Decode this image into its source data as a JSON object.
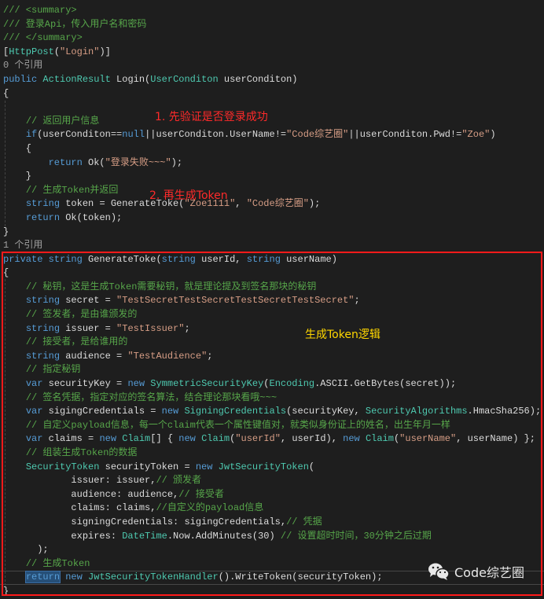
{
  "colors": {
    "background": "#1e1e1e",
    "keyword": "#569cd6",
    "type": "#4ec9b0",
    "string": "#d69d85",
    "comment": "#57a64a",
    "highlight_box": "#ff1a1a",
    "annotation_red": "#ff2a2a",
    "annotation_yellow": "#ffd700"
  },
  "annotations": {
    "step1": "1. 先验证是否登录成功",
    "step2": "2. 再生成Token",
    "box_label": "生成Token逻辑"
  },
  "watermark": {
    "icon": "wechat-icon",
    "text": "Code综艺圈"
  },
  "code_lines": [
    [
      [
        "cm",
        "/// <summary>"
      ]
    ],
    [
      [
        "cm",
        "/// 登录Api，传入用户名和密码"
      ]
    ],
    [
      [
        "cm",
        "/// </summary>"
      ]
    ],
    [
      [
        "pl",
        "["
      ],
      [
        "ty",
        "HttpPost"
      ],
      [
        "pl",
        "("
      ],
      [
        "str",
        "\"Login\""
      ],
      [
        "pl",
        ")]"
      ]
    ],
    [
      [
        "ref",
        "0 个引用"
      ]
    ],
    [
      [
        "kw",
        "public "
      ],
      [
        "ty",
        "ActionResult"
      ],
      [
        "pl",
        " Login("
      ],
      [
        "ty",
        "UserConditon"
      ],
      [
        "pl",
        " userConditon)"
      ]
    ],
    [
      [
        "pl",
        "{"
      ]
    ],
    [],
    [
      [
        "pl",
        "    "
      ],
      [
        "cm",
        "// 返回用户信息"
      ]
    ],
    [
      [
        "pl",
        "    "
      ],
      [
        "kw",
        "if"
      ],
      [
        "pl",
        "(userConditon=="
      ],
      [
        "kw",
        "null"
      ],
      [
        "pl",
        "||userConditon.UserName!="
      ],
      [
        "str",
        "\"Code综艺圈\""
      ],
      [
        "pl",
        "||userConditon.Pwd!="
      ],
      [
        "str",
        "\"Zoe\""
      ],
      [
        "pl",
        ")"
      ]
    ],
    [
      [
        "pl",
        "    {"
      ]
    ],
    [
      [
        "pl",
        "        "
      ],
      [
        "kw",
        "return"
      ],
      [
        "pl",
        " Ok("
      ],
      [
        "str",
        "\"登录失败~~~\""
      ],
      [
        "pl",
        ");"
      ]
    ],
    [
      [
        "pl",
        "    }"
      ]
    ],
    [
      [
        "pl",
        "    "
      ],
      [
        "cm",
        "// 生成Token并返回"
      ]
    ],
    [
      [
        "pl",
        "    "
      ],
      [
        "kw",
        "string"
      ],
      [
        "pl",
        " token = GenerateToke("
      ],
      [
        "str",
        "\"Zoe1111\""
      ],
      [
        "pl",
        ", "
      ],
      [
        "str",
        "\"Code综艺圈\""
      ],
      [
        "pl",
        ");"
      ]
    ],
    [
      [
        "pl",
        "    "
      ],
      [
        "kw",
        "return"
      ],
      [
        "pl",
        " Ok(token);"
      ]
    ],
    [
      [
        "pl",
        "}"
      ]
    ],
    [
      [
        "ref",
        "1 个引用"
      ]
    ],
    [
      [
        "kw",
        "private string"
      ],
      [
        "pl",
        " GenerateToke("
      ],
      [
        "kw",
        "string"
      ],
      [
        "pl",
        " userId, "
      ],
      [
        "kw",
        "string"
      ],
      [
        "pl",
        " userName)"
      ]
    ],
    [
      [
        "pl",
        "{"
      ]
    ],
    [
      [
        "pl",
        "    "
      ],
      [
        "cm",
        "// 秘钥，这是生成Token需要秘钥，就是理论提及到签名那块的秘钥"
      ]
    ],
    [
      [
        "pl",
        "    "
      ],
      [
        "kw",
        "string"
      ],
      [
        "pl",
        " secret = "
      ],
      [
        "str",
        "\"TestSecretTestSecretTestSecretTestSecret\""
      ],
      [
        "pl",
        ";"
      ]
    ],
    [
      [
        "pl",
        "    "
      ],
      [
        "cm",
        "// 签发者，是由谁颁发的"
      ]
    ],
    [
      [
        "pl",
        "    "
      ],
      [
        "kw",
        "string"
      ],
      [
        "pl",
        " issuer = "
      ],
      [
        "str",
        "\"TestIssuer\""
      ],
      [
        "pl",
        ";"
      ]
    ],
    [
      [
        "pl",
        "    "
      ],
      [
        "cm",
        "// 接受者，是给谁用的"
      ]
    ],
    [
      [
        "pl",
        "    "
      ],
      [
        "kw",
        "string"
      ],
      [
        "pl",
        " audience = "
      ],
      [
        "str",
        "\"TestAudience\""
      ],
      [
        "pl",
        ";"
      ]
    ],
    [
      [
        "pl",
        "    "
      ],
      [
        "cm",
        "// 指定秘钥"
      ]
    ],
    [
      [
        "pl",
        "    "
      ],
      [
        "kw",
        "var"
      ],
      [
        "pl",
        " securityKey = "
      ],
      [
        "kw",
        "new "
      ],
      [
        "ty",
        "SymmetricSecurityKey"
      ],
      [
        "pl",
        "("
      ],
      [
        "ty",
        "Encoding"
      ],
      [
        "pl",
        ".ASCII.GetBytes(secret));"
      ]
    ],
    [
      [
        "pl",
        "    "
      ],
      [
        "cm",
        "// 签名凭据，指定对应的签名算法，结合理论那块看哦~~~"
      ]
    ],
    [
      [
        "pl",
        "    "
      ],
      [
        "kw",
        "var"
      ],
      [
        "pl",
        " sigingCredentials = "
      ],
      [
        "kw",
        "new "
      ],
      [
        "ty",
        "SigningCredentials"
      ],
      [
        "pl",
        "(securityKey, "
      ],
      [
        "ty",
        "SecurityAlgorithms"
      ],
      [
        "pl",
        ".HmacSha256);"
      ]
    ],
    [
      [
        "pl",
        "    "
      ],
      [
        "cm",
        "// 自定义payload信息，每一个claim代表一个属性键值对，就类似身份证上的姓名，出生年月一样"
      ]
    ],
    [
      [
        "pl",
        "    "
      ],
      [
        "kw",
        "var"
      ],
      [
        "pl",
        " claims = "
      ],
      [
        "kw",
        "new "
      ],
      [
        "ty",
        "Claim"
      ],
      [
        "pl",
        "[] { "
      ],
      [
        "kw",
        "new "
      ],
      [
        "ty",
        "Claim"
      ],
      [
        "pl",
        "("
      ],
      [
        "str",
        "\"userId\""
      ],
      [
        "pl",
        ", userId), "
      ],
      [
        "kw",
        "new "
      ],
      [
        "ty",
        "Claim"
      ],
      [
        "pl",
        "("
      ],
      [
        "str",
        "\"userName\""
      ],
      [
        "pl",
        ", userName) };"
      ]
    ],
    [
      [
        "pl",
        "    "
      ],
      [
        "cm",
        "// 组装生成Token的数据"
      ]
    ],
    [
      [
        "pl",
        "    "
      ],
      [
        "ty",
        "SecurityToken"
      ],
      [
        "pl",
        " securityToken = "
      ],
      [
        "kw",
        "new "
      ],
      [
        "ty",
        "JwtSecurityToken"
      ],
      [
        "pl",
        "("
      ]
    ],
    [
      [
        "pl",
        "            issuer: issuer,"
      ],
      [
        "cm",
        "// 颁发者"
      ]
    ],
    [
      [
        "pl",
        "            audience: audience,"
      ],
      [
        "cm",
        "// 接受者"
      ]
    ],
    [
      [
        "pl",
        "            claims: claims,"
      ],
      [
        "cm",
        "//自定义的payload信息"
      ]
    ],
    [
      [
        "pl",
        "            signingCredentials: sigingCredentials,"
      ],
      [
        "cm",
        "// 凭据"
      ]
    ],
    [
      [
        "pl",
        "            expires: "
      ],
      [
        "ty",
        "DateTime"
      ],
      [
        "pl",
        ".Now.AddMinutes(30) "
      ],
      [
        "cm",
        "// 设置超时时间，30分钟之后过期"
      ]
    ],
    [
      [
        "pl",
        "      );"
      ]
    ],
    [
      [
        "pl",
        "    "
      ],
      [
        "cm",
        "// 生成Token"
      ]
    ],
    [
      [
        "pl",
        "    "
      ],
      [
        "sel",
        "return"
      ],
      [
        "pl",
        " "
      ],
      [
        "kw",
        "new "
      ],
      [
        "ty",
        "JwtSecurityTokenHandler"
      ],
      [
        "pl",
        "().WriteToken(securityToken);"
      ]
    ],
    [
      [
        "pl",
        "}"
      ]
    ]
  ]
}
